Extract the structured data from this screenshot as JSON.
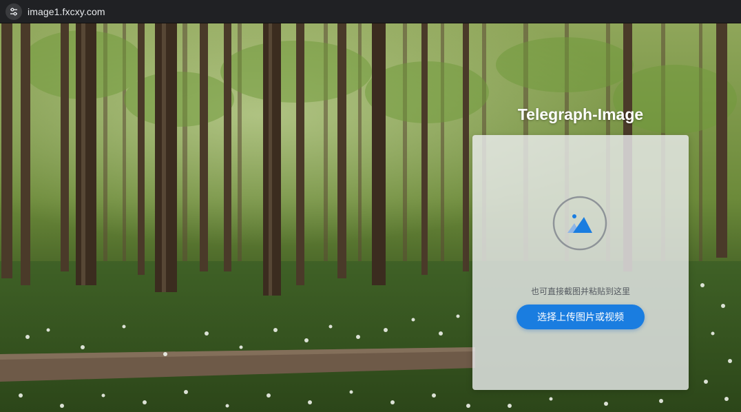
{
  "browser": {
    "url": "image1.fxcxy.com",
    "site_info_icon": "tune-icon"
  },
  "page": {
    "title": "Telegraph-Image",
    "background": "forest-photo"
  },
  "upload": {
    "icon": "image-upload-icon",
    "hint": "也可直接截图并粘贴到这里",
    "button_label": "选择上传图片或视频",
    "accent_color": "#1a7de0"
  }
}
